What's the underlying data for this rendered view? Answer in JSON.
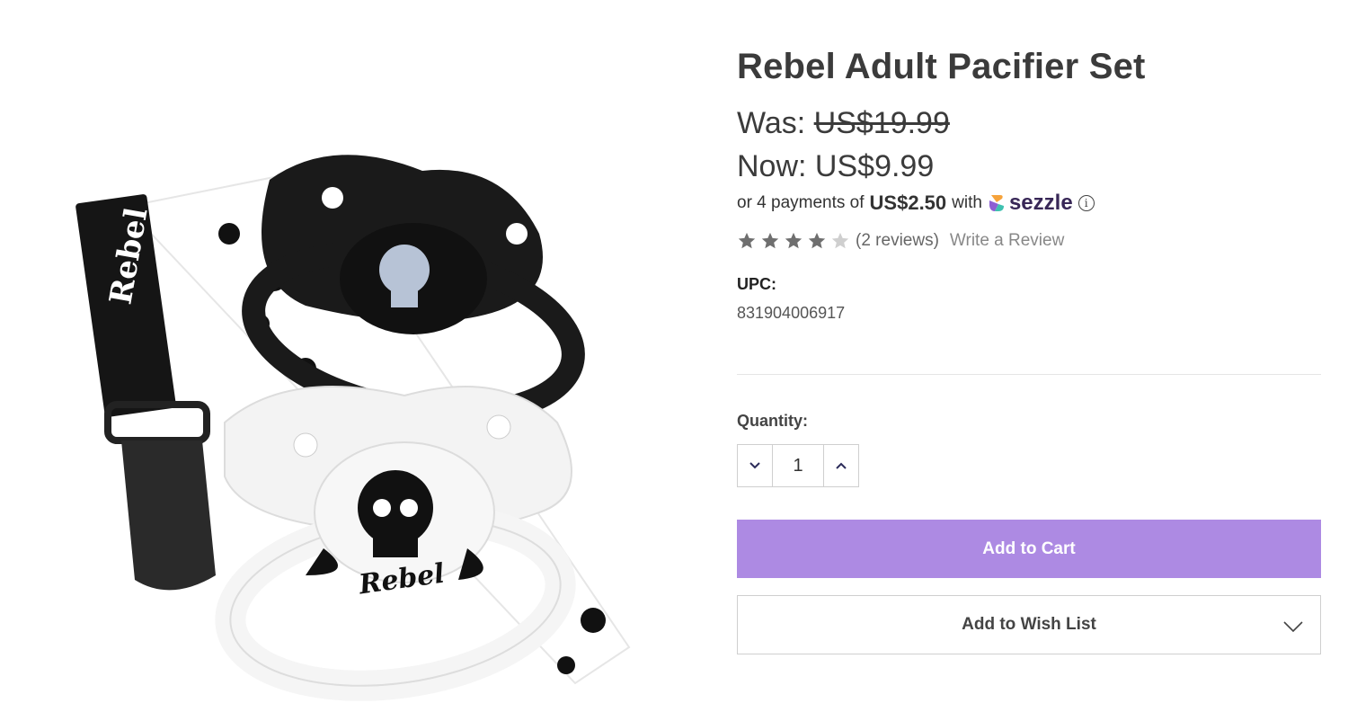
{
  "product": {
    "title": "Rebel Adult Pacifier Set",
    "was_label": "Was:",
    "was_price": "US$19.99",
    "now_label": "Now:",
    "now_price": "US$9.99",
    "installment": {
      "prefix": "or 4 payments of",
      "amount": "US$2.50",
      "suffix": "with",
      "provider": "sezzle",
      "info_icon": "info-icon"
    },
    "rating": {
      "stars": 4,
      "max": 5,
      "reviews_text": "(2 reviews)",
      "write_review": "Write a Review"
    },
    "upc_label": "UPC:",
    "upc_value": "831904006917",
    "image_text": "Rebel",
    "image_icon": "product-photo-pacifier-set"
  },
  "purchase": {
    "quantity_label": "Quantity:",
    "quantity_value": "1",
    "decrease_icon": "chevron-down-icon",
    "increase_icon": "chevron-up-icon",
    "add_to_cart": "Add to Cart",
    "add_to_wishlist": "Add to Wish List",
    "wishlist_icon": "chevron-down-icon"
  },
  "colors": {
    "accent": "#ad8ae3",
    "text": "#3b3b3b",
    "border": "#cfcfcf"
  }
}
